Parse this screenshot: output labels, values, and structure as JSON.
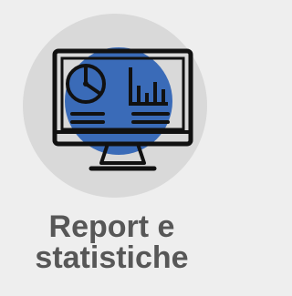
{
  "tile": {
    "icon": "monitor-chart-report-icon",
    "title_line1": "Report e",
    "title_line2": "statistiche"
  },
  "colors": {
    "background": "#eeeeee",
    "circle": "#d9d9d9",
    "accent": "#3a6bb8",
    "stroke": "#111111",
    "text": "#575757"
  }
}
